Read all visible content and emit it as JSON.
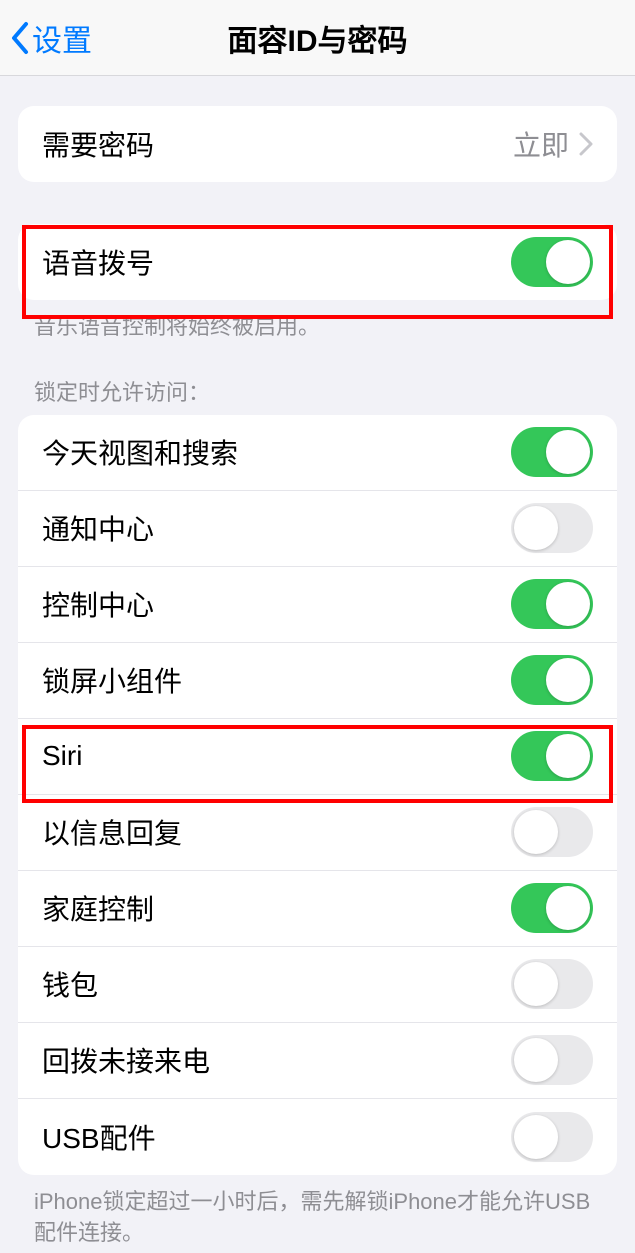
{
  "nav": {
    "back_label": "设置",
    "title": "面容ID与密码"
  },
  "passcode_group": {
    "require_passcode_label": "需要密码",
    "require_passcode_value": "立即"
  },
  "voice_dial": {
    "label": "语音拨号",
    "on": true,
    "footer": "音乐语音控制将始终被启用。"
  },
  "locked_access": {
    "header": "锁定时允许访问：",
    "items": [
      {
        "label": "今天视图和搜索",
        "on": true
      },
      {
        "label": "通知中心",
        "on": false
      },
      {
        "label": "控制中心",
        "on": true
      },
      {
        "label": "锁屏小组件",
        "on": true
      },
      {
        "label": "Siri",
        "on": true
      },
      {
        "label": "以信息回复",
        "on": false
      },
      {
        "label": "家庭控制",
        "on": true
      },
      {
        "label": "钱包",
        "on": false
      },
      {
        "label": "回拨未接来电",
        "on": false
      },
      {
        "label": "USB配件",
        "on": false
      }
    ],
    "footer": "iPhone锁定超过一小时后，需先解锁iPhone才能允许USB配件连接。"
  }
}
